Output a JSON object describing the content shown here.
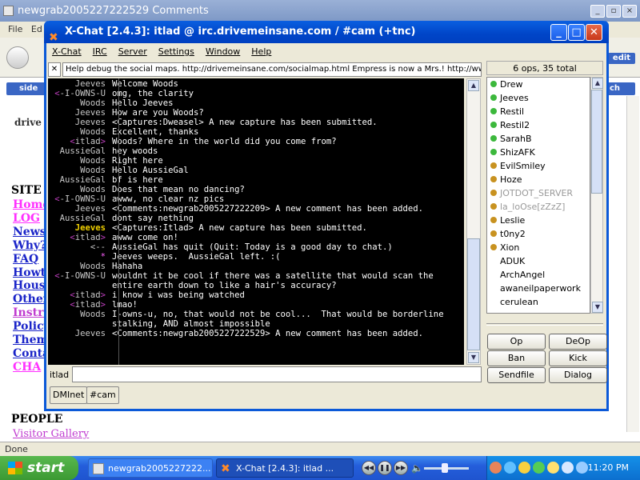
{
  "browser": {
    "title": "newgrab2005227222529 Comments",
    "menu": [
      "File",
      "Ed"
    ],
    "edit_label": "edit",
    "side_tab": "side",
    "side_tab2": "ch",
    "site_heading": "SITE",
    "site_links": [
      "Home",
      "LOG",
      "News",
      "Why?",
      "FAQ",
      "Howto",
      "House",
      "Other",
      "Instru",
      "Policy",
      "Them",
      "Conta",
      "CHA"
    ],
    "people_heading": "PEOPLE",
    "visitor_gallery": "Visitor Gallery",
    "status": "Done",
    "logo": "drive"
  },
  "xchat": {
    "title": "X-Chat [2.4.3]: itlad @ irc.drivemeinsane.com / #cam (+tnc)",
    "menu": [
      "X-Chat",
      "IRC",
      "Server",
      "Settings",
      "Window",
      "Help"
    ],
    "topic": "Help debug the social maps.  http://drivemeinsane.com/socialmap.html  Empress is now a Mrs.!  http://www.",
    "ops_summary": "6 ops, 35 total",
    "input_nick": "itlad",
    "tabs": [
      "DMInet",
      "#cam"
    ],
    "buttons": [
      "Op",
      "DeOp",
      "Ban",
      "Kick",
      "Sendfile",
      "Dialog"
    ],
    "messages": [
      {
        "nick": "Jeeves",
        "text": "Welcome Woods",
        "nick_color": "#c8c8c8"
      },
      {
        "nick": "-I-OWNS-U",
        "text": "omg, the clarity",
        "nick_color": "#c8c8c8",
        "prefix": "<"
      },
      {
        "nick": "Woods",
        "text": "Hello Jeeves",
        "nick_color": "#c8c8c8"
      },
      {
        "nick": "Jeeves",
        "text": "How are you Woods?",
        "nick_color": "#c8c8c8"
      },
      {
        "nick": "Jeeves",
        "text": "<Captures:Dweasel> A new capture has been submitted.",
        "nick_color": "#c8c8c8"
      },
      {
        "nick": "Woods",
        "text": "Excellent, thanks",
        "nick_color": "#c8c8c8"
      },
      {
        "nick": "itlad",
        "text": "Woods? Where in the world did you come from?",
        "nick_color": "#c8c8c8",
        "prefix": "<",
        "suffix": ">"
      },
      {
        "nick": "AussieGal",
        "text": "hey woods",
        "nick_color": "#c8c8c8"
      },
      {
        "nick": "Woods",
        "text": "Right here",
        "nick_color": "#c8c8c8"
      },
      {
        "nick": "Woods",
        "text": "Hello AussieGal",
        "nick_color": "#c8c8c8"
      },
      {
        "nick": "AussieGal",
        "text": "bf is here",
        "nick_color": "#c8c8c8"
      },
      {
        "nick": "Woods",
        "text": "Does that mean no dancing?",
        "nick_color": "#c8c8c8"
      },
      {
        "nick": "-I-OWNS-U",
        "text": "awww, no clear nz pics",
        "nick_color": "#c8c8c8",
        "prefix": "<"
      },
      {
        "nick": "Jeeves",
        "text": "<Comments:newgrab2005227222209> A new comment has been added.",
        "nick_color": "#c8c8c8"
      },
      {
        "nick": "AussieGal",
        "text": "dont say nething",
        "nick_color": "#c8c8c8"
      },
      {
        "nick": "Jeeves",
        "text": "<Captures:Itlad> A new capture has been submitted.",
        "nick_color": "#f0d000"
      },
      {
        "nick": "itlad",
        "text": "awww come on!",
        "nick_color": "#c8c8c8",
        "prefix": "<",
        "suffix": ">"
      },
      {
        "nick": "<--",
        "text": "AussieGal has quit (Quit: Today is a good day to chat.)",
        "nick_color": "#c8c8c8"
      },
      {
        "nick": "*",
        "text": "Jeeves weeps.  AussieGal left. :(",
        "nick_color": "#ff60ff"
      },
      {
        "nick": "Woods",
        "text": "Hahaha",
        "nick_color": "#c8c8c8"
      },
      {
        "nick": "-I-OWNS-U",
        "text": "wouldnt it be cool if there was a satellite that would scan the entire earth down to like a hair's accuracy?",
        "nick_color": "#c8c8c8",
        "prefix": "<"
      },
      {
        "nick": "itlad",
        "text": "i know i was being watched",
        "nick_color": "#c8c8c8",
        "prefix": "<",
        "suffix": ">"
      },
      {
        "nick": "itlad",
        "text": "lmao!",
        "nick_color": "#c8c8c8",
        "prefix": "<",
        "suffix": ">"
      },
      {
        "nick": "Woods",
        "text": "I-owns-u, no, that would not be cool...  That would be borderline stalking, AND almost impossible",
        "nick_color": "#c8c8c8"
      },
      {
        "nick": "Jeeves",
        "text": "<Comments:newgrab2005227222529> A new comment has been added.",
        "nick_color": "#c8c8c8"
      }
    ],
    "users": [
      {
        "name": "Drew",
        "status": "op"
      },
      {
        "name": "Jeeves",
        "status": "op"
      },
      {
        "name": "Restil",
        "status": "op"
      },
      {
        "name": "Restil2",
        "status": "op"
      },
      {
        "name": "SarahB",
        "status": "op"
      },
      {
        "name": "ShizAFK",
        "status": "op"
      },
      {
        "name": "EvilSmiley",
        "status": "voice"
      },
      {
        "name": "Hoze",
        "status": "voice"
      },
      {
        "name": "JOTDOT_SERVER",
        "status": "away"
      },
      {
        "name": "la_loOse[zZzZ]",
        "status": "away"
      },
      {
        "name": "Leslie",
        "status": "voice"
      },
      {
        "name": "t0ny2",
        "status": "voice"
      },
      {
        "name": "Xion",
        "status": "voice"
      },
      {
        "name": "ADUK",
        "status": "none"
      },
      {
        "name": "ArchAngel",
        "status": "none"
      },
      {
        "name": "awaneilpaperwork",
        "status": "none"
      },
      {
        "name": "cerulean",
        "status": "none"
      }
    ]
  },
  "taskbar": {
    "start": "start",
    "tasks": [
      "newgrab2005227222...",
      "X-Chat [2.4.3]: itlad ..."
    ],
    "clock": "11:20 PM"
  },
  "colors": {
    "op": "#3cb83c",
    "voice": "#c89220",
    "xp_blue": "#0a5fe0",
    "chat_bg": "#000000"
  }
}
